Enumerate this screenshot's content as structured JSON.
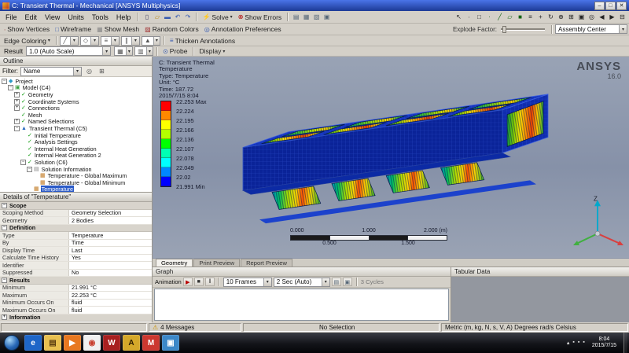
{
  "window": {
    "title": "C: Transient Thermal - Mechanical [ANSYS Multiphysics]"
  },
  "menus": [
    "File",
    "Edit",
    "View",
    "Units",
    "Tools",
    "Help"
  ],
  "toolbar_main": {
    "icons_left": [
      "new-file-icon",
      "open-file-icon",
      "save-file-icon",
      "undo-icon",
      "redo-icon"
    ],
    "solve_label": "Solve",
    "show_errors_label": "Show Errors",
    "icons_mid": [
      "worksheet-icon",
      "chart-icon",
      "report-preview-icon",
      "image-capture-icon"
    ],
    "icons_right": [
      "select-mode-icon",
      "single-select-icon",
      "box-select-icon",
      "select-vertex-icon",
      "select-edge-icon",
      "select-face-icon",
      "select-body-icon",
      "extend-selection-icon",
      "pan-icon",
      "rotate-icon",
      "zoom-icon",
      "box-zoom-icon",
      "fit-view-icon",
      "look-at-icon",
      "previous-view-icon",
      "next-view-icon",
      "manage-views-icon"
    ]
  },
  "toolbar_display": {
    "buttons": [
      {
        "icon": "show-vertices-icon",
        "label": "Show Vertices"
      },
      {
        "icon": "wireframe-icon",
        "label": "Wireframe"
      },
      {
        "icon": "show-mesh-icon",
        "label": "Show Mesh"
      },
      {
        "icon": "random-colors-icon",
        "label": "Random Colors"
      },
      {
        "icon": "annotation-preferences-icon",
        "label": "Annotation Preferences"
      }
    ],
    "explode_label": "Explode Factor:",
    "assembly_value": "Assembly Center"
  },
  "toolbar_edge": {
    "edge_coloring_label": "Edge Coloring",
    "option_icons": [
      "edge-direction-icon",
      "edge-cross-section-icon",
      "edge-thickness-icon",
      "edge-scale-icon",
      "edge-display-icon"
    ],
    "thicken_label": "Thicken Annotations"
  },
  "toolbar_result": {
    "label": "Result",
    "scale_value": "1.0 (Auto Scale)",
    "option_icons": [
      "contours-option-icon",
      "edges-option-icon"
    ],
    "probe_label": "Probe",
    "display_label": "Display"
  },
  "outline": {
    "title": "Outline",
    "filter_label": "Filter:",
    "filter_value": "Name",
    "tree": [
      {
        "label": "Project",
        "level": 0,
        "expand": "open",
        "icon": "project-icon"
      },
      {
        "label": "Model (C4)",
        "level": 1,
        "expand": "open",
        "icon": "model-icon"
      },
      {
        "label": "Geometry",
        "level": 2,
        "expand": "closed",
        "icon": "check-icon"
      },
      {
        "label": "Coordinate Systems",
        "level": 2,
        "expand": "closed",
        "icon": "check-icon"
      },
      {
        "label": "Connections",
        "level": 2,
        "expand": "closed",
        "icon": "check-icon"
      },
      {
        "label": "Mesh",
        "level": 2,
        "expand": "none",
        "icon": "check-icon"
      },
      {
        "label": "Named Selections",
        "level": 2,
        "expand": "closed",
        "icon": "check-icon"
      },
      {
        "label": "Transient Thermal (C5)",
        "level": 2,
        "expand": "open",
        "icon": "transient-thermal-icon"
      },
      {
        "label": "Initial Temperature",
        "level": 3,
        "expand": "none",
        "icon": "check-icon"
      },
      {
        "label": "Analysis Settings",
        "level": 3,
        "expand": "none",
        "icon": "check-icon"
      },
      {
        "label": "Internal Heat Generation",
        "level": 3,
        "expand": "none",
        "icon": "check-icon"
      },
      {
        "label": "Internal Heat Generation 2",
        "level": 3,
        "expand": "none",
        "icon": "check-icon"
      },
      {
        "label": "Solution (C6)",
        "level": 3,
        "expand": "open",
        "icon": "solution-icon"
      },
      {
        "label": "Solution Information",
        "level": 4,
        "expand": "open",
        "icon": "solution-info-icon"
      },
      {
        "label": "Temperature - Global Maximum",
        "level": 5,
        "expand": "none",
        "icon": "result-icon"
      },
      {
        "label": "Temperature - Global Minimum",
        "level": 5,
        "expand": "none",
        "icon": "result-icon"
      },
      {
        "label": "Temperature",
        "level": 4,
        "expand": "none",
        "icon": "result-icon",
        "selected": true
      }
    ]
  },
  "details": {
    "title": "Details of \"Temperature\"",
    "sections": [
      {
        "header": "Scope",
        "collapsed": false,
        "rows": [
          [
            "Scoping Method",
            "Geometry Selection"
          ],
          [
            "Geometry",
            "2 Bodies"
          ]
        ]
      },
      {
        "header": "Definition",
        "collapsed": false,
        "rows": [
          [
            "Type",
            "Temperature"
          ],
          [
            "By",
            "Time"
          ],
          [
            "Display Time",
            "Last"
          ],
          [
            "Calculate Time History",
            "Yes"
          ],
          [
            "Identifier",
            ""
          ],
          [
            "Suppressed",
            "No"
          ]
        ]
      },
      {
        "header": "Results",
        "collapsed": false,
        "rows": [
          [
            "Minimum",
            "21.991 °C"
          ],
          [
            "Maximum",
            "22.253 °C"
          ],
          [
            "Minimum Occurs On",
            "fluid"
          ],
          [
            "Maximum Occurs On",
            "fluid"
          ]
        ]
      },
      {
        "header": "Information",
        "collapsed": true,
        "rows": []
      }
    ]
  },
  "viewport": {
    "legend": {
      "title": "C: Transient Thermal",
      "result_name": "Temperature",
      "type_line": "Type: Temperature",
      "unit_line": "Unit: °C",
      "time_line": "Time: 187.72",
      "datetime_line": "2015/7/15 8:04"
    },
    "brand": {
      "name": "ANSYS",
      "version": "16.0"
    },
    "colorbar": {
      "labels": [
        "22.253 Max",
        "22.224",
        "22.195",
        "22.166",
        "22.136",
        "22.107",
        "22.078",
        "22.049",
        "22.02",
        "21.991 Min"
      ],
      "colors": [
        "#ff0000",
        "#ff8800",
        "#ffff00",
        "#b3ff00",
        "#00ff00",
        "#00ffb3",
        "#00ffff",
        "#0088ff",
        "#0000ff"
      ]
    },
    "scalebar": {
      "top_labels": [
        "0.000",
        "1.000",
        "2.000 (m)"
      ],
      "bottom_labels": [
        "0.500",
        "1.500"
      ]
    },
    "triad": {
      "z_label": "Z"
    }
  },
  "view_tabs": [
    "Geometry",
    "Print Preview",
    "Report Preview"
  ],
  "graph": {
    "title": "Graph",
    "animation_label": "Animation",
    "frames_value": "10 Frames",
    "duration_value": "2 Sec (Auto)",
    "cycles_label": "3 Cycles"
  },
  "tabular": {
    "title": "Tabular Data"
  },
  "statusbar": {
    "messages": "4 Messages",
    "selection": "No Selection",
    "units": "Metric (m, kg, N, s, V, A) Degrees rad/s Celsius"
  },
  "taskbar": {
    "icons": [
      "ie-icon",
      "explorer-icon",
      "media-player-icon",
      "chrome-icon",
      "ansys-workbench-icon",
      "ansys-icon",
      "mail-icon",
      "picture-icon"
    ],
    "tray_icons": [
      "hidden-icons-icon",
      "system-icon",
      "network-icon",
      "volume-icon"
    ],
    "time": "8:04",
    "date": "2015/7/15"
  }
}
